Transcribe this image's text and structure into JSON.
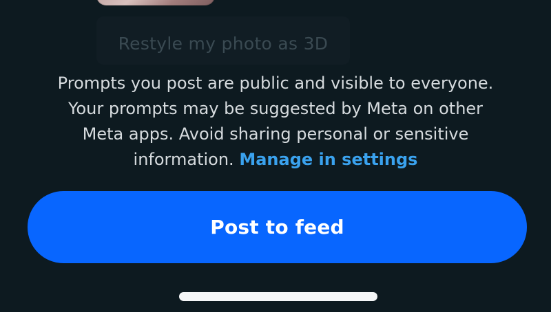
{
  "prompt_chip": {
    "text": "Restyle my photo as 3D"
  },
  "disclaimer": {
    "lines": [
      "Prompts you post are public and visible to everyone.",
      "Your prompts may be suggested by Meta on other",
      "Meta apps. Avoid sharing personal or sensitive",
      "information."
    ],
    "link_label": "Manage in settings"
  },
  "post_button": {
    "label": "Post to feed"
  },
  "colors": {
    "background": "#0d1a20",
    "primary_button": "#0866ff",
    "link": "#3aa2ee",
    "text": "#d6dbde"
  }
}
